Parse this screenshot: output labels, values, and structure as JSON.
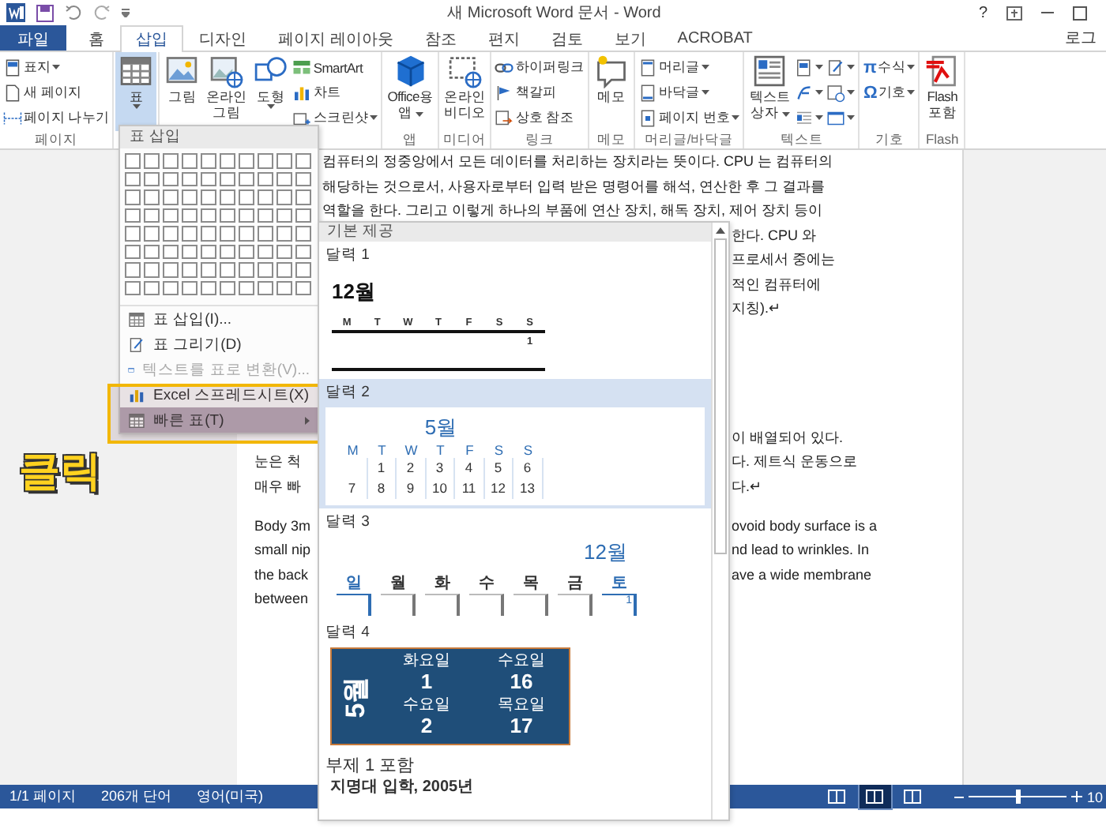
{
  "title_bar": {
    "title": "새 Microsoft Word 문서 - Word",
    "help": "?"
  },
  "tabs": [
    {
      "label": "파일",
      "kind": "file",
      "selected": false
    },
    {
      "label": "홈",
      "kind": "tab",
      "selected": false
    },
    {
      "label": "삽입",
      "kind": "tab",
      "selected": true
    },
    {
      "label": "디자인",
      "kind": "tab",
      "selected": false
    },
    {
      "label": "페이지 레이아웃",
      "kind": "tab",
      "selected": false
    },
    {
      "label": "참조",
      "kind": "tab",
      "selected": false
    },
    {
      "label": "편지",
      "kind": "tab",
      "selected": false
    },
    {
      "label": "검토",
      "kind": "tab",
      "selected": false
    },
    {
      "label": "보기",
      "kind": "tab",
      "selected": false
    },
    {
      "label": "ACROBAT",
      "kind": "tab",
      "selected": false
    }
  ],
  "account": "로그",
  "ribbon": {
    "groups": [
      {
        "label": "페이지",
        "columns": [
          {
            "kind": "stack",
            "items": [
              {
                "label": "표지",
                "dropdown": true
              },
              {
                "label": "새 페이지",
                "dropdown": false
              },
              {
                "label": "페이지 나누기",
                "dropdown": false
              }
            ]
          }
        ]
      },
      {
        "columns": [
          {
            "kind": "large",
            "lines": [
              "표"
            ],
            "dropdown": true,
            "pressed": true
          }
        ]
      },
      {
        "columns": [
          {
            "kind": "large",
            "lines": [
              "그림"
            ],
            "dropdown": false,
            "pressed": false
          },
          {
            "kind": "large",
            "lines": [
              "온라인",
              "그림"
            ],
            "dropdown": false,
            "pressed": false
          },
          {
            "kind": "large",
            "lines": [
              "도형"
            ],
            "dropdown": true,
            "pressed": false
          },
          {
            "kind": "stack",
            "items": [
              {
                "label": "SmartArt",
                "dropdown": false
              },
              {
                "label": "차트",
                "dropdown": false
              },
              {
                "label": "스크린샷",
                "dropdown": true
              }
            ]
          }
        ]
      },
      {
        "label": "앱",
        "columns": [
          {
            "kind": "large",
            "lines": [
              "Office용",
              "앱"
            ],
            "dropdown": true,
            "pressed": false
          }
        ]
      },
      {
        "label": "미디어",
        "columns": [
          {
            "kind": "large",
            "lines": [
              "온라인",
              "비디오"
            ],
            "dropdown": false,
            "pressed": false
          }
        ]
      },
      {
        "label": "링크",
        "columns": [
          {
            "kind": "stack",
            "items": [
              {
                "label": "하이퍼링크",
                "dropdown": false
              },
              {
                "label": "책갈피",
                "dropdown": false
              },
              {
                "label": "상호 참조",
                "dropdown": false
              }
            ]
          }
        ]
      },
      {
        "label": "메모",
        "columns": [
          {
            "kind": "large",
            "lines": [
              "메모"
            ],
            "dropdown": false,
            "pressed": false
          }
        ]
      },
      {
        "label": "머리글/바닥글",
        "columns": [
          {
            "kind": "stack",
            "items": [
              {
                "label": "머리글",
                "dropdown": true
              },
              {
                "label": "바닥글",
                "dropdown": true
              },
              {
                "label": "페이지 번호",
                "dropdown": true
              }
            ]
          }
        ]
      },
      {
        "label": "텍스트",
        "columns": [
          {
            "kind": "large",
            "lines": [
              "텍스트",
              "상자"
            ],
            "dropdown": true,
            "pressed": false
          },
          {
            "kind": "stack",
            "items": [
              {
                "dropdown": true
              },
              {
                "dropdown": true
              },
              {
                "dropdown": true
              }
            ]
          },
          {
            "kind": "stack",
            "items": [
              {
                "dropdown": true
              },
              {
                "dropdown": true
              },
              {
                "dropdown": true
              }
            ]
          }
        ]
      },
      {
        "label": "기호",
        "columns": [
          {
            "kind": "stack",
            "items": [
              {
                "glyph": "π",
                "label": "수식",
                "dropdown": true
              },
              {
                "glyph": "Ω",
                "label": "기호",
                "dropdown": true
              }
            ]
          }
        ]
      },
      {
        "label": "Flash",
        "columns": [
          {
            "kind": "large",
            "lines": [
              "Flash",
              "포함"
            ],
            "dropdown": false,
            "pressed": false
          }
        ]
      }
    ]
  },
  "document": {
    "lines": [
      {
        "kind": "full",
        "text": "컴퓨터의 정중앙에서 모든 데이터를 처리하는 장치라는 뜻이다. CPU 는 컴퓨터의"
      },
      {
        "kind": "full",
        "text": "해당하는 것으로서, 사용자로부터 입력 받은 명령어를 해석, 연산한 후 그 결과를"
      },
      {
        "kind": "full",
        "text": "역할을 한다. 그리고 이렇게 하나의 부품에 연산 장치, 해독 장치, 제어 장치 등이"
      },
      {
        "kind": "split",
        "right": "한다. CPU 와"
      },
      {
        "kind": "split",
        "right": "프로세서 중에는"
      },
      {
        "kind": "split",
        "right": "적인 컴퓨터에"
      },
      {
        "kind": "split",
        "right": "지칭).↵"
      },
      {
        "kind": "blank"
      },
      {
        "kind": "blank"
      },
      {
        "kind": "blank"
      },
      {
        "kind": "blank"
      },
      {
        "kind": "split",
        "right": "이 배열되어 있다."
      },
      {
        "kind": "split",
        "left": "눈은 척",
        "right": "다. 제트식 운동으로"
      },
      {
        "kind": "split",
        "left": "매우 빠",
        "right": "다.↵"
      },
      {
        "kind": "space"
      },
      {
        "kind": "split",
        "left": "Body 3m",
        "right": "ovoid body surface is a"
      },
      {
        "kind": "split",
        "left": "small nip",
        "right": "nd lead to wrinkles. In"
      },
      {
        "kind": "split",
        "left": "the back",
        "right": "ave a wide membrane"
      },
      {
        "kind": "split",
        "left": "between"
      }
    ]
  },
  "annotation": {
    "text": "클릭"
  },
  "table_menu": {
    "header": "표 삽입",
    "items": [
      {
        "label": "표 삽입(I)...",
        "kind": "item",
        "disabled": false,
        "selected": false
      },
      {
        "label": "표 그리기(D)",
        "kind": "item",
        "disabled": false,
        "selected": false
      },
      {
        "label": "텍스트를 표로 변환(V)...",
        "kind": "item",
        "disabled": true,
        "selected": false
      },
      {
        "label": "Excel 스프레드시트(X)",
        "kind": "item",
        "disabled": false,
        "selected": false
      },
      {
        "label": "빠른 표(T)",
        "kind": "submenu",
        "disabled": false,
        "selected": true
      }
    ]
  },
  "gallery": {
    "header": "기본 제공",
    "items": [
      {
        "label": "달력 1",
        "kind": "cal1",
        "selected": false,
        "month": "12월",
        "weekdays": [
          "M",
          "T",
          "W",
          "T",
          "F",
          "S",
          "S"
        ],
        "rows": [
          [
            "",
            "",
            "",
            "",
            "",
            "",
            "1"
          ]
        ]
      },
      {
        "label": "달력 2",
        "kind": "cal2",
        "selected": true,
        "month": "5월",
        "weekdays": [
          "M",
          "T",
          "W",
          "T",
          "F",
          "S",
          "S"
        ],
        "rows": [
          [
            "",
            "1",
            "2",
            "3",
            "4",
            "5",
            "6"
          ],
          [
            "7",
            "8",
            "9",
            "10",
            "11",
            "12",
            "13"
          ]
        ]
      },
      {
        "label": "달력 3",
        "kind": "cal3",
        "selected": false,
        "month": "12월",
        "weekdays": [
          "일",
          "월",
          "화",
          "수",
          "목",
          "금",
          "토"
        ],
        "rows": [
          [
            "",
            "",
            "",
            "",
            "",
            "",
            "1"
          ]
        ]
      },
      {
        "label": "달력 4",
        "kind": "cal4",
        "selected": false,
        "month": "5월",
        "cells": [
          {
            "day": "화요일",
            "date": "1"
          },
          {
            "day": "수요일",
            "date": "16"
          },
          {
            "day": "수요일",
            "date": "2"
          },
          {
            "day": "목요일",
            "date": "17"
          }
        ]
      },
      {
        "label": "부제 1 포함",
        "kind": "subtitle",
        "selected": false,
        "text": "지명대 입학, 2005년"
      }
    ]
  },
  "status_bar": {
    "items": [
      "1/1 페이지",
      "206개 단어",
      "영어(미국)"
    ],
    "views": [
      {
        "selected": false
      },
      {
        "selected": true
      },
      {
        "selected": false
      }
    ],
    "zoom": {
      "level": 0.5,
      "text": "10"
    }
  }
}
